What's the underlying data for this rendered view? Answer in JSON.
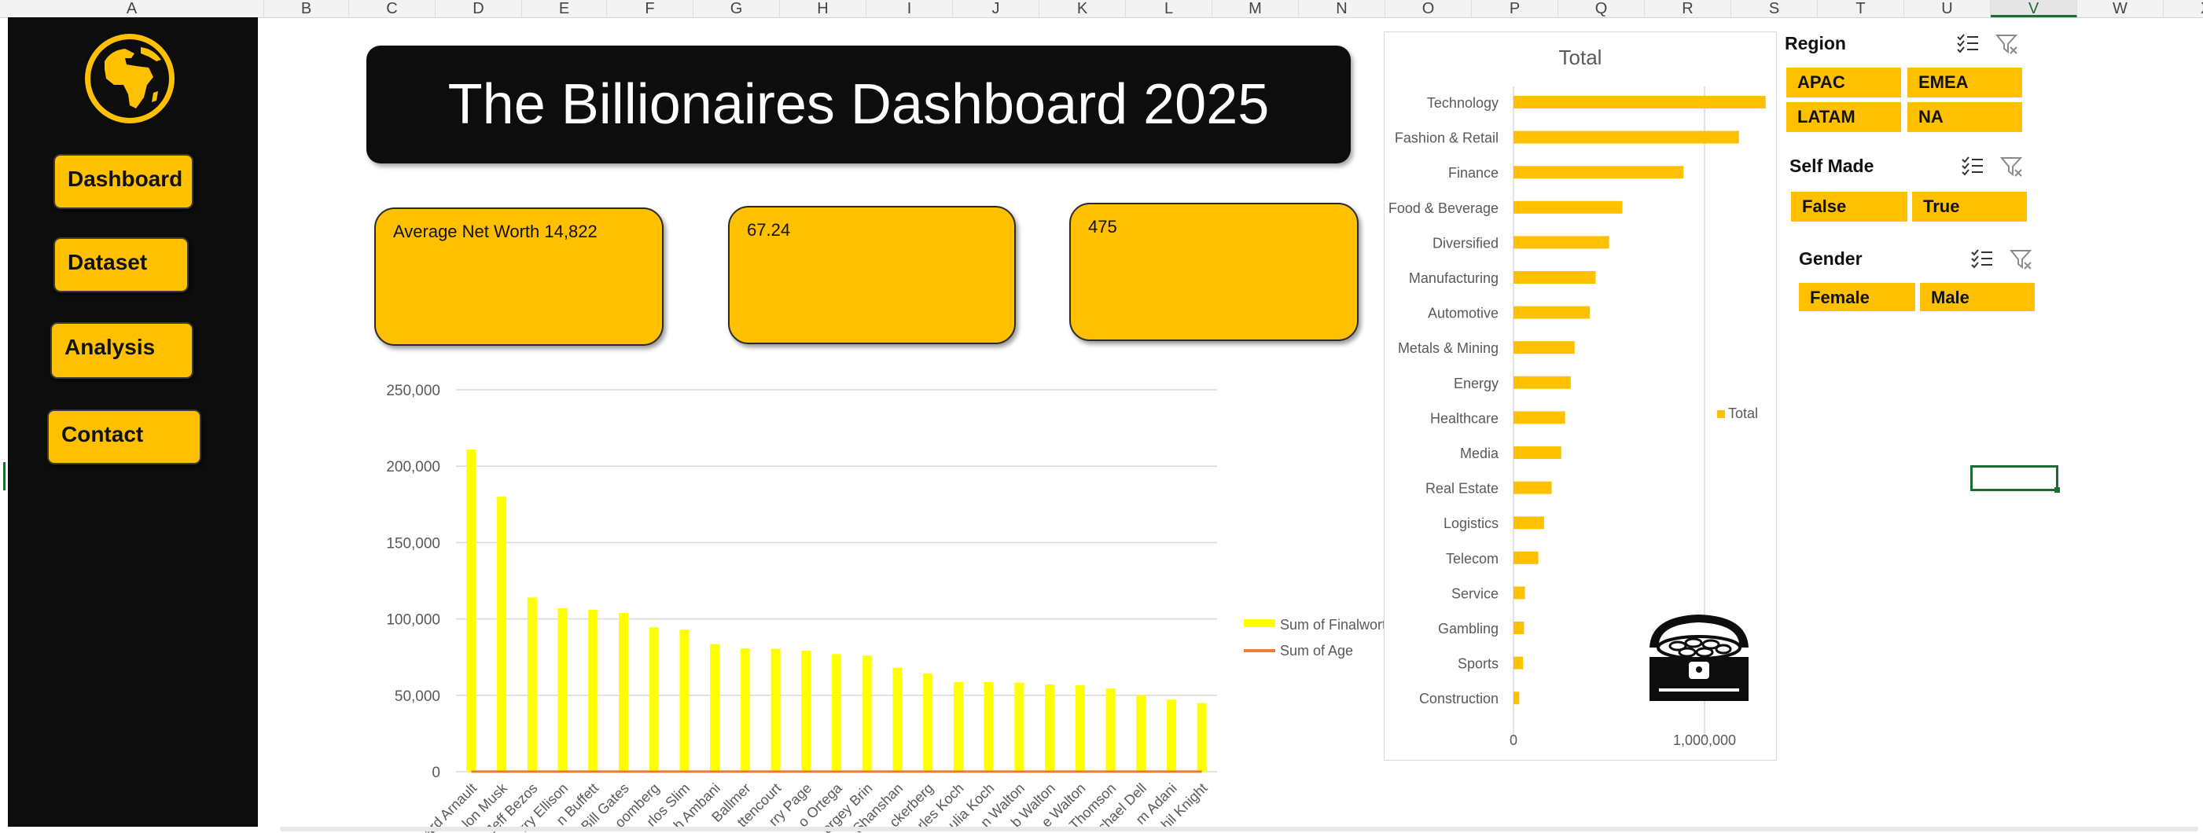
{
  "columns": [
    "A",
    "B",
    "C",
    "D",
    "E",
    "F",
    "G",
    "H",
    "I",
    "J",
    "K",
    "L",
    "M",
    "N",
    "O",
    "P",
    "Q",
    "R",
    "S",
    "T",
    "U",
    "V",
    "W",
    "X"
  ],
  "active_column": "V",
  "sidebar": {
    "logo_icon": "globe-africa-icon",
    "buttons": [
      {
        "label": "Dashboard"
      },
      {
        "label": "Dataset"
      },
      {
        "label": "Analysis"
      },
      {
        "label": "Contact"
      }
    ]
  },
  "title": "The Billionaires Dashboard 2025",
  "kpis": [
    {
      "text": "Average Net Worth 14,822"
    },
    {
      "text": "67.24"
    },
    {
      "text": "475"
    }
  ],
  "colors": {
    "accent": "#ffc000",
    "bar_yellow": "#ffff00",
    "age_line": "#ed7d31",
    "dark": "#0d0d0d"
  },
  "chart_data": [
    {
      "type": "bar",
      "categories": [
        "Bernard Arnault",
        "Elon Musk",
        "Jeff Bezos",
        "Larry Ellison",
        "Warren Buffett",
        "Bill Gates",
        "Michael Bloomberg",
        "Carlos Slim",
        "Mukesh Ambani",
        "Steve Ballmer",
        "Francoise Bettencourt",
        "Larry Page",
        "Amancio Ortega",
        "Sergey Brin",
        "Zhong Shanshan",
        "Mark Zuckerberg",
        "Charles Koch",
        "Julia Koch",
        "Jim Walton",
        "Rob Walton",
        "Alice Walton",
        "David Thomson",
        "Michael Dell",
        "Gautam Adani",
        "Phil Knight"
      ],
      "tick_labels": [
        "rnard Arnault",
        "lon Musk",
        "Jeff Bezos",
        "rry Ellison",
        "n Buffett",
        "Bill Gates",
        "oomberg",
        "rlos Slim",
        "h Ambani",
        "Ballmer",
        "ttencourt",
        "rry Page",
        "o Ortega",
        "ergey Brin",
        "Shanshan",
        "ckerberg",
        "rles Koch",
        "ulia Koch",
        "n Walton",
        "b Walton",
        "e Walton",
        "Thomson",
        "chael Dell",
        "m Adani",
        "hil Knight"
      ],
      "series": [
        {
          "name": "Sum of Finalworth",
          "values": [
            211000,
            180000,
            114000,
            107000,
            106000,
            104000,
            94500,
            93000,
            83500,
            80700,
            80500,
            79200,
            77000,
            76000,
            68000,
            64400,
            58600,
            58600,
            58300,
            57100,
            56600,
            54400,
            50100,
            47200,
            44900
          ]
        },
        {
          "name": "Sum of Age",
          "values": [
            74,
            51,
            59,
            78,
            92,
            67,
            81,
            83,
            65,
            67,
            69,
            50,
            87,
            49,
            68,
            39,
            87,
            60,
            74,
            78,
            73,
            65,
            58,
            60,
            85
          ]
        }
      ],
      "legend_labels": [
        "Sum of Finalwort",
        "Sum of Age"
      ],
      "ylim": [
        0,
        250000
      ],
      "yticks": [
        "0",
        "50,000",
        "100,000",
        "150,000",
        "200,000",
        "250,000"
      ],
      "legend": "right"
    },
    {
      "type": "bar",
      "orientation": "horizontal",
      "title": "Total",
      "categories": [
        "Technology",
        "Fashion & Retail",
        "Finance",
        "Food & Beverage",
        "Diversified",
        "Manufacturing",
        "Automotive",
        "Metals & Mining",
        "Energy",
        "Healthcare",
        "Media",
        "Real Estate",
        "Logistics",
        "Telecom",
        "Service",
        "Gambling",
        "Sports",
        "Construction"
      ],
      "series": [
        {
          "name": "Total",
          "values": [
            1320000,
            1180000,
            890000,
            570000,
            500000,
            430000,
            400000,
            320000,
            300000,
            270000,
            250000,
            200000,
            160000,
            130000,
            60000,
            55000,
            50000,
            30000
          ]
        }
      ],
      "xlim": [
        0,
        2000000
      ],
      "xticks": [
        "0",
        "1,000,000"
      ],
      "legend": "right"
    }
  ],
  "chest_icon": "treasure-chest-icon",
  "slicers": [
    {
      "title": "Region",
      "items": [
        "APAC",
        "EMEA",
        "LATAM",
        "NA"
      ]
    },
    {
      "title": "Self Made",
      "items": [
        "False",
        "True"
      ]
    },
    {
      "title": "Gender",
      "items": [
        "Female",
        "Male"
      ]
    }
  ]
}
